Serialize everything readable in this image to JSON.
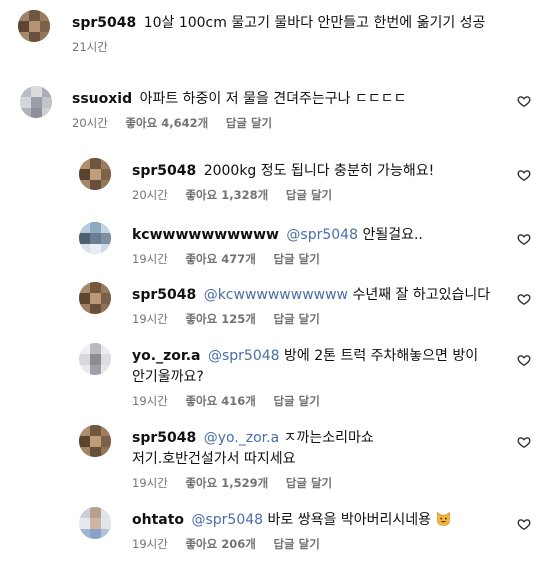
{
  "colors": {
    "text": "#111111",
    "meta": "#737373",
    "mention": "#4a6ea8"
  },
  "comments": [
    {
      "username": "spr5048",
      "text": "10살 100cm 물고기 물바다 안만들고 한번에 옮기기 성공",
      "time": "21시간",
      "likes": "",
      "reply": ""
    },
    {
      "username": "ssuoxid",
      "text": "아파트 하중이 저 물을 견뎌주는구나 ㄷㄷㄷㄷ",
      "time": "20시간",
      "likes": "좋아요 4,642개",
      "reply": "답글 달기"
    },
    {
      "username": "spr5048",
      "text": "2000kg 정도 됩니다 충분히 가능해요!",
      "time": "20시간",
      "likes": "좋아요 1,328개",
      "reply": "답글 달기"
    },
    {
      "username": "kcwwwwwwwwww",
      "mention": "@spr5048",
      "text": "안될걸요..",
      "time": "19시간",
      "likes": "좋아요 477개",
      "reply": "답글 달기"
    },
    {
      "username": "spr5048",
      "mention": "@kcwwwwwwwwww",
      "text": "수년째 잘 하고있습니다",
      "time": "19시간",
      "likes": "좋아요 125개",
      "reply": "답글 달기"
    },
    {
      "username": "yo._zor.a",
      "mention": "@spr5048",
      "text": "방에 2톤 트럭 주차해놓으면 방이 안기울까요?",
      "time": "19시간",
      "likes": "좋아요 416개",
      "reply": "답글 달기"
    },
    {
      "username": "spr5048",
      "mention": "@yo._zor.a",
      "text": "ㅈ까는소리마쇼 저기.호반건설가서 따지세요",
      "time": "19시간",
      "likes": "좋아요 1,529개",
      "reply": "답글 달기"
    },
    {
      "username": "ohtato",
      "mention": "@spr5048",
      "text": "바로 쌍욕을 박아버리시네용",
      "time": "19시간",
      "likes": "좋아요 206개",
      "reply": "답글 달기"
    }
  ]
}
